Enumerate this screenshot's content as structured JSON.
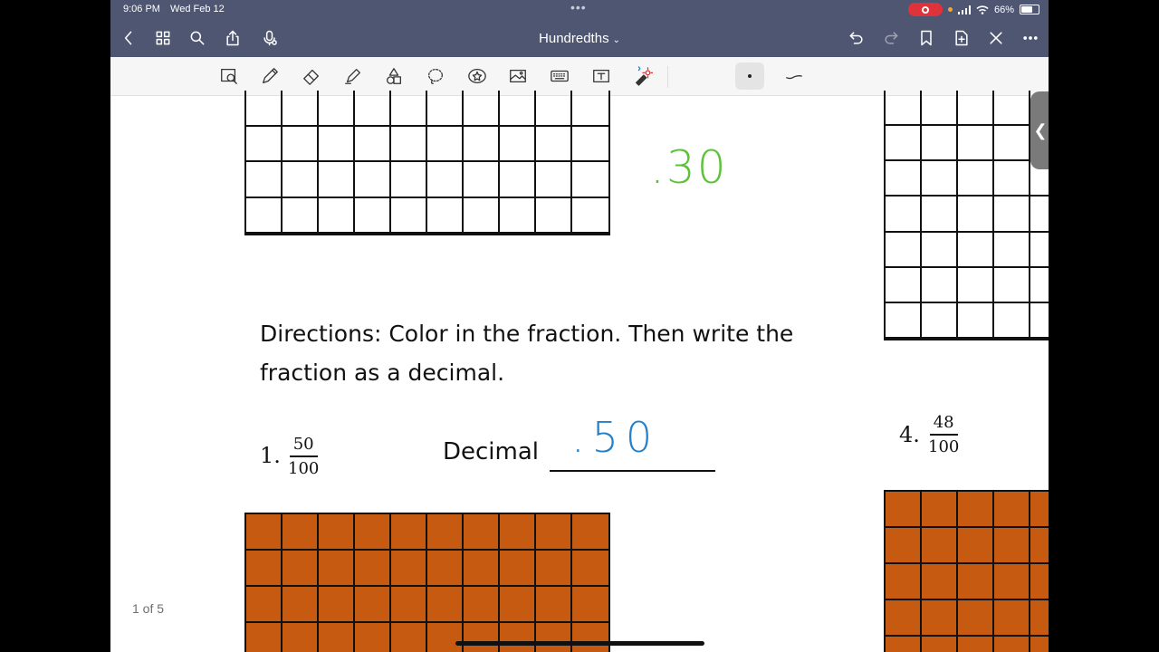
{
  "status": {
    "time": "9:06 PM",
    "date": "Wed Feb 12",
    "battery": "66%",
    "dots": "•••"
  },
  "nav": {
    "title": "Hundredths"
  },
  "document": {
    "directions_line1": "Directions: Color in the fraction. Then write the",
    "directions_line2": "fraction as a decimal.",
    "problem1": {
      "number": "1.",
      "numerator": "50",
      "denominator": "100",
      "decimal_label": "Decimal",
      "handwritten_answer": ".50",
      "grid_filled_fraction": 1.0
    },
    "problem4": {
      "number": "4.",
      "numerator": "48",
      "denominator": "100"
    },
    "handwritten_prev_answer": ".30",
    "page_indicator": "1 of 5"
  },
  "colors": {
    "nav_bar": "#4f5672",
    "fill": "#c65a10",
    "green_ink": "#5cc23a",
    "blue_ink": "#2380c9",
    "record": "#e0323a"
  },
  "icons": {
    "nav": [
      "back-icon",
      "grid-icon",
      "search-icon",
      "share-icon",
      "microphone-icon",
      "undo-icon",
      "redo-icon",
      "bookmark-icon",
      "add-page-icon",
      "close-icon",
      "more-icon"
    ],
    "tools": [
      "zoom-window-icon",
      "pen-icon",
      "eraser-icon",
      "highlighter-icon",
      "shapes-icon",
      "lasso-icon",
      "sticker-icon",
      "image-icon",
      "keyboard-icon",
      "text-icon",
      "laser-pointer-icon"
    ]
  }
}
